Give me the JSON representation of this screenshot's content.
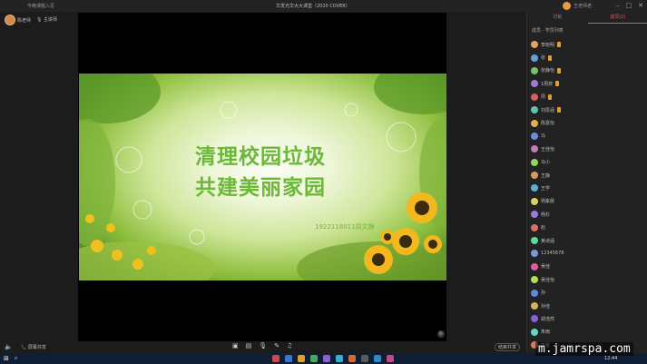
{
  "titlebar": {
    "left_title": "今晚课题入见",
    "center_title": "华发光华大大课堂（2020 COVER）",
    "user_name": "王老师老",
    "window_buttons": [
      "–",
      "□",
      "✕"
    ]
  },
  "host": {
    "name": "陈老师",
    "mic_label": "主讲师"
  },
  "slide": {
    "title_line1": "清理校园垃圾",
    "title_line2": "共建美丽家园",
    "subtitle": "1922118011周文静"
  },
  "toolbar": {
    "share_label": "屏幕共享",
    "tools": [
      "camera-icon",
      "chat-icon",
      "mic-icon",
      "pen-icon",
      "music-icon"
    ],
    "end_label": "结束共享"
  },
  "panel": {
    "tabs": [
      {
        "label": "讨论",
        "active": false
      },
      {
        "label": "成员(2)",
        "active": true
      }
    ],
    "list_header": "成员 · 学员列表",
    "participants": [
      {
        "name": "李晓明",
        "color": "#e6a45c",
        "badge": true
      },
      {
        "name": "张",
        "color": "#5fa3d8",
        "badge": true
      },
      {
        "name": "张静怡",
        "color": "#7bbf6a",
        "badge": true
      },
      {
        "name": "1周奕",
        "color": "#a07ad0",
        "badge": true
      },
      {
        "name": "周",
        "color": "#d85f5f",
        "badge": true
      },
      {
        "name": "刘思涵",
        "color": "#5fc2b5",
        "badge": true
      },
      {
        "name": "陈嘉怡",
        "color": "#e0b050",
        "badge": false
      },
      {
        "name": "马",
        "color": "#6a8fd8",
        "badge": false
      },
      {
        "name": "王佳怡",
        "color": "#c77ab7",
        "badge": false
      },
      {
        "name": "马小",
        "color": "#8fd85f",
        "badge": false
      },
      {
        "name": "王静",
        "color": "#d89a5f",
        "badge": false
      },
      {
        "name": "王学",
        "color": "#5fb0d8",
        "badge": false
      },
      {
        "name": "杨紫晨",
        "color": "#d8d35f",
        "badge": false
      },
      {
        "name": "杨杉",
        "color": "#9a7ad8",
        "badge": false
      },
      {
        "name": "赵",
        "color": "#d8705f",
        "badge": false
      },
      {
        "name": "黄诗涵",
        "color": "#5fd89a",
        "badge": false
      },
      {
        "name": "12345678",
        "color": "#7a9ad8",
        "badge": false
      },
      {
        "name": "吴佳",
        "color": "#d85fa0",
        "badge": false
      },
      {
        "name": "吴佳怡",
        "color": "#b5d85f",
        "badge": false
      },
      {
        "name": "孙",
        "color": "#5f8ad8",
        "badge": false
      },
      {
        "name": "孙佳",
        "color": "#d8b05f",
        "badge": false
      },
      {
        "name": "胡浩然",
        "color": "#8a5fd8",
        "badge": false
      },
      {
        "name": "朱雨",
        "color": "#5fd8c2",
        "badge": false
      },
      {
        "name": "高雅",
        "color": "#d87a5f",
        "badge": false
      }
    ]
  },
  "taskbar": {
    "clock": "12:44"
  },
  "watermark": "m.jamrspa.com"
}
